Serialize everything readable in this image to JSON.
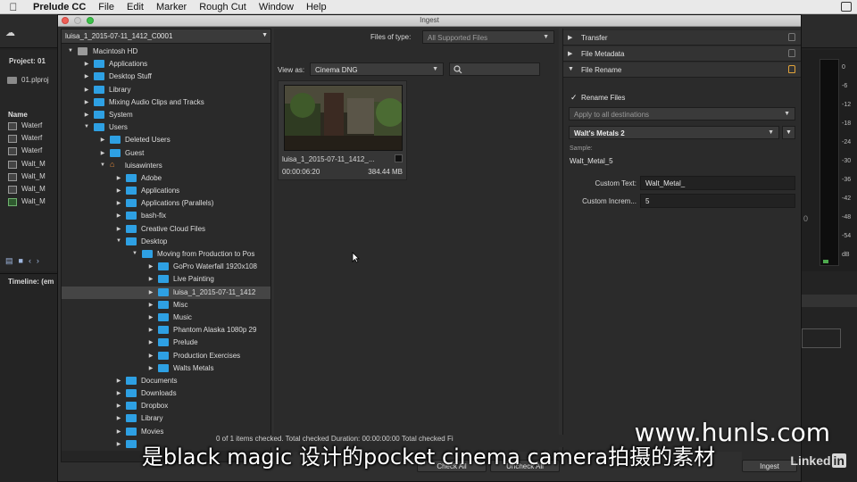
{
  "menubar": {
    "app": "Prelude CC",
    "items": [
      "File",
      "Edit",
      "Marker",
      "Rough Cut",
      "Window",
      "Help"
    ]
  },
  "background": {
    "project_title": "Project: 01",
    "project_file": "01.plproj",
    "name_header": "Name",
    "clips": [
      "Waterf",
      "Waterf",
      "Waterf",
      "Walt_M",
      "Walt_M",
      "Walt_M",
      "Walt_M"
    ],
    "timeline": "Timeline: (em",
    "meter_zero": "0",
    "db_scale": [
      "0",
      "-6",
      "-12",
      "-18",
      "-24",
      "-30",
      "-36",
      "-42",
      "-48",
      "-54",
      "dB"
    ]
  },
  "dialog": {
    "title": "Ingest",
    "path": "luisa_1_2015-07-11_1412_C0001",
    "tree": [
      {
        "label": "Macintosh HD",
        "depth": 0,
        "open": true,
        "icon": "hd"
      },
      {
        "label": "Applications",
        "depth": 1,
        "open": false
      },
      {
        "label": "Desktop Stuff",
        "depth": 1,
        "open": false
      },
      {
        "label": "Library",
        "depth": 1,
        "open": false
      },
      {
        "label": "Mixing Audio Clips and Tracks",
        "depth": 1,
        "open": false
      },
      {
        "label": "System",
        "depth": 1,
        "open": false
      },
      {
        "label": "Users",
        "depth": 1,
        "open": true
      },
      {
        "label": "Deleted Users",
        "depth": 2,
        "open": false
      },
      {
        "label": "Guest",
        "depth": 2,
        "open": false
      },
      {
        "label": "luisawinters",
        "depth": 2,
        "open": true,
        "icon": "home"
      },
      {
        "label": "Adobe",
        "depth": 3,
        "open": false
      },
      {
        "label": "Applications",
        "depth": 3,
        "open": false
      },
      {
        "label": "Applications (Parallels)",
        "depth": 3,
        "open": false
      },
      {
        "label": "bash-fix",
        "depth": 3,
        "open": false
      },
      {
        "label": "Creative Cloud Files",
        "depth": 3,
        "open": false
      },
      {
        "label": "Desktop",
        "depth": 3,
        "open": true
      },
      {
        "label": "Moving from Production to Pos",
        "depth": 4,
        "open": true
      },
      {
        "label": "GoPro Waterfall 1920x108",
        "depth": 5,
        "open": false
      },
      {
        "label": "Live Painting",
        "depth": 5,
        "open": false
      },
      {
        "label": "luisa_1_2015-07-11_1412",
        "depth": 5,
        "open": false,
        "selected": true
      },
      {
        "label": "Misc",
        "depth": 5,
        "open": false
      },
      {
        "label": "Music",
        "depth": 5,
        "open": false
      },
      {
        "label": "Phantom Alaska 1080p 29",
        "depth": 5,
        "open": false
      },
      {
        "label": "Prelude",
        "depth": 5,
        "open": false
      },
      {
        "label": "Production Exercises",
        "depth": 5,
        "open": false
      },
      {
        "label": "Walts Metals",
        "depth": 5,
        "open": false
      },
      {
        "label": "Documents",
        "depth": 3,
        "open": false
      },
      {
        "label": "Downloads",
        "depth": 3,
        "open": false
      },
      {
        "label": "Dropbox",
        "depth": 3,
        "open": false
      },
      {
        "label": "Library",
        "depth": 3,
        "open": false
      },
      {
        "label": "Movies",
        "depth": 3,
        "open": false
      },
      {
        "label": "",
        "depth": 3,
        "open": false
      }
    ],
    "files_of_type_label": "Files of type:",
    "files_of_type_value": "All Supported Files",
    "view_as_label": "View as:",
    "view_as_value": "Cinema DNG",
    "clip": {
      "name": "luisa_1_2015-07-11_1412_...",
      "duration": "00:00:06:20",
      "size": "384.44 MB"
    },
    "status": "0 of 1 items checked.   Total checked Duration: 00:00:00:00    Total checked Fi",
    "check_all": "Check All",
    "uncheck_all": "Uncheck All",
    "ingest": "Ingest",
    "sections": {
      "transfer": "Transfer",
      "file_metadata": "File Metadata",
      "file_rename": "File Rename"
    },
    "rename_files_label": "Rename Files",
    "apply_to": "Apply to all destinations",
    "preset": "Walt's Metals 2",
    "sample_label": "Sample:",
    "sample_value": "Walt_Metal_5",
    "custom_text_label": "Custom Text:",
    "custom_text_value": "Walt_Metal_",
    "custom_incr_label": "Custom Increm...",
    "custom_incr_value": "5"
  },
  "overlay": {
    "subtitle": "是black magic 设计的pocket cinema camera拍摄的素材",
    "watermark": "www.hunls.com",
    "linkedin_a": "Linked",
    "linkedin_b": "in"
  },
  "colors": {
    "folder": "#2ea0e3",
    "accent_lock": "#e1a33a"
  }
}
